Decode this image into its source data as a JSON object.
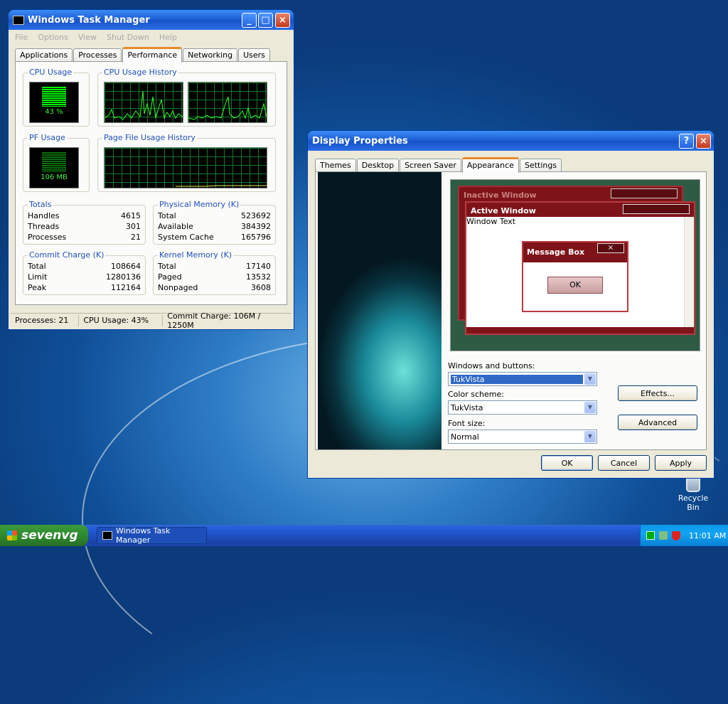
{
  "task_manager": {
    "title": "Windows Task Manager",
    "menu": [
      "File",
      "Options",
      "View",
      "Shut Down",
      "Help"
    ],
    "tabs": [
      "Applications",
      "Processes",
      "Performance",
      "Networking",
      "Users"
    ],
    "active_tab": "Performance",
    "cpu_usage_label": "CPU Usage",
    "cpu_usage_value": "43 %",
    "cpu_history_label": "CPU Usage History",
    "pf_usage_label": "PF Usage",
    "pf_usage_value": "106 MB",
    "pf_history_label": "Page File Usage History",
    "totals": {
      "label": "Totals",
      "rows": [
        {
          "k": "Handles",
          "v": "4615"
        },
        {
          "k": "Threads",
          "v": "301"
        },
        {
          "k": "Processes",
          "v": "21"
        }
      ]
    },
    "physical": {
      "label": "Physical Memory (K)",
      "rows": [
        {
          "k": "Total",
          "v": "523692"
        },
        {
          "k": "Available",
          "v": "384392"
        },
        {
          "k": "System Cache",
          "v": "165796"
        }
      ]
    },
    "commit": {
      "label": "Commit Charge (K)",
      "rows": [
        {
          "k": "Total",
          "v": "108664"
        },
        {
          "k": "Limit",
          "v": "1280136"
        },
        {
          "k": "Peak",
          "v": "112164"
        }
      ]
    },
    "kernel": {
      "label": "Kernel Memory (K)",
      "rows": [
        {
          "k": "Total",
          "v": "17140"
        },
        {
          "k": "Paged",
          "v": "13532"
        },
        {
          "k": "Nonpaged",
          "v": "3608"
        }
      ]
    },
    "status": {
      "processes": "Processes: 21",
      "cpu": "CPU Usage: 43%",
      "commit": "Commit Charge: 106M / 1250M"
    }
  },
  "display_props": {
    "title": "Display Properties",
    "tabs": [
      "Themes",
      "Desktop",
      "Screen Saver",
      "Appearance",
      "Settings"
    ],
    "active_tab": "Appearance",
    "preview": {
      "inactive": "Inactive Window",
      "active": "Active Window",
      "window_text": "Window Text",
      "msgbox": "Message Box",
      "ok": "OK"
    },
    "windows_buttons_label": "Windows and buttons:",
    "windows_buttons_value": "TukVista",
    "color_scheme_label": "Color scheme:",
    "color_scheme_value": "TukVista",
    "font_size_label": "Font size:",
    "font_size_value": "Normal",
    "effects_btn": "Effects...",
    "advanced_btn": "Advanced",
    "ok": "OK",
    "cancel": "Cancel",
    "apply": "Apply"
  },
  "desktop": {
    "recycle_bin": "Recycle Bin"
  },
  "taskbar": {
    "start": "sevenvg",
    "item": "Windows Task Manager",
    "clock": "11:01 AM"
  }
}
